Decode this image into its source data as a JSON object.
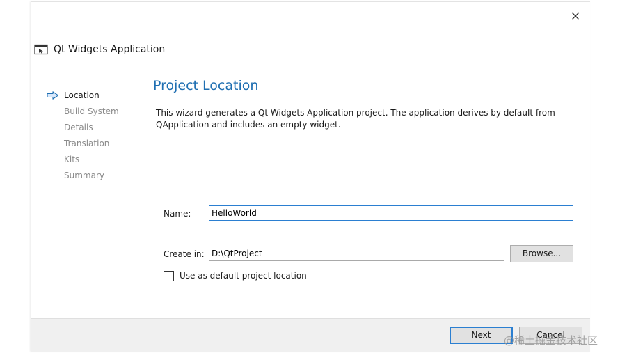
{
  "window": {
    "close_icon": "close-icon"
  },
  "header": {
    "app_icon": "window-icon",
    "title": "Qt Widgets Application"
  },
  "sidebar": {
    "active_icon": "arrow-right-icon",
    "steps": [
      {
        "label": "Location",
        "active": true
      },
      {
        "label": "Build System",
        "active": false
      },
      {
        "label": "Details",
        "active": false
      },
      {
        "label": "Translation",
        "active": false
      },
      {
        "label": "Kits",
        "active": false
      },
      {
        "label": "Summary",
        "active": false
      }
    ]
  },
  "main": {
    "title": "Project Location",
    "description": "This wizard generates a Qt Widgets Application project. The application derives by default from QApplication and includes an empty widget.",
    "name_label": "Name:",
    "name_value": "HelloWorld",
    "create_in_label": "Create in:",
    "create_in_value": "D:\\QtProject",
    "browse_label": "Browse...",
    "default_location_label": "Use as default project location",
    "default_location_checked": false
  },
  "footer": {
    "next_label": "Next",
    "cancel_label": "Cancel"
  },
  "watermark": "@稀土掘金技术社区",
  "colors": {
    "title_blue": "#1f6fb2",
    "focus_blue": "#2b7fd1",
    "footer_bg": "#f0f0f0",
    "inactive_step": "#8a8a8a"
  }
}
